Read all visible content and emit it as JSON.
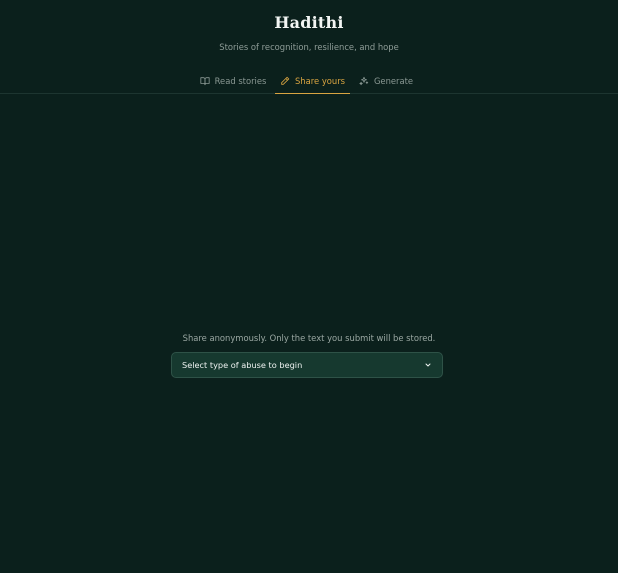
{
  "header": {
    "title": "Hadithi",
    "subtitle": "Stories of recognition, resilience, and hope"
  },
  "tabs": [
    {
      "label": "Read stories",
      "icon": "book-open-icon"
    },
    {
      "label": "Share yours",
      "icon": "pencil-icon",
      "active": true
    },
    {
      "label": "Generate",
      "icon": "sparkles-icon"
    }
  ],
  "share": {
    "note": "Share anonymously. Only the text you submit will be stored.",
    "select_value": "Select type of abuse to begin"
  },
  "colors": {
    "background": "#0b201c",
    "accent": "#d9a441",
    "select_bg": "#16392f"
  }
}
